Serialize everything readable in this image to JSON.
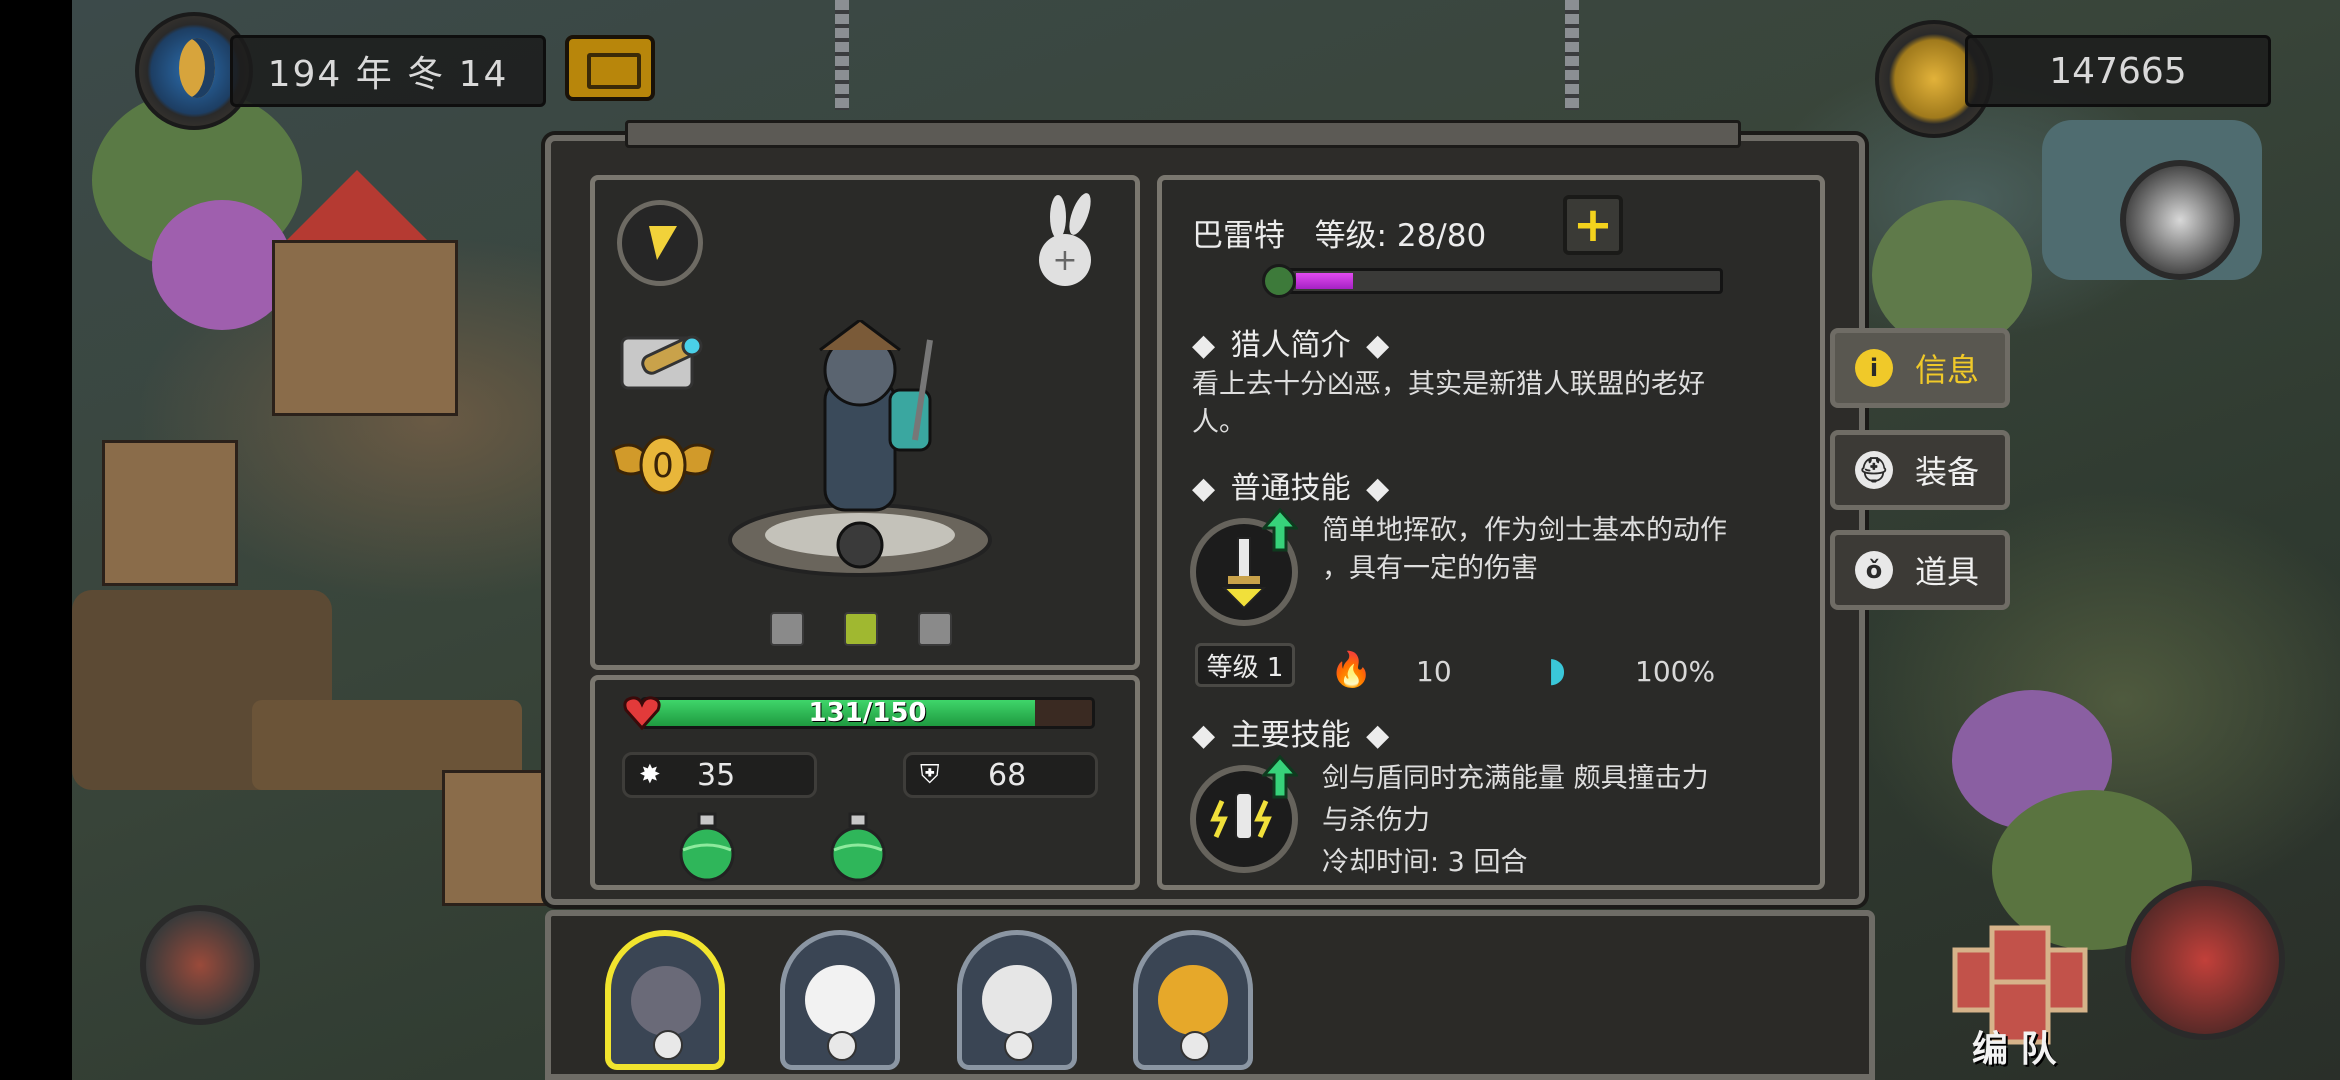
{
  "hud": {
    "date": "194 年 冬 14",
    "gold": "147665"
  },
  "hero": {
    "name": "巴雷特",
    "level_label": "等级: 28/80",
    "xp_fraction": 0.13,
    "rank_value": "0",
    "hp_text": "131/150",
    "hp_fraction": 0.873,
    "attack": "35",
    "defense": "68"
  },
  "profile": {
    "title": "猎人简介",
    "text_line1": "看上去十分凶恶，其实是新猎人联盟的老好",
    "text_line2": "人。"
  },
  "normal_skill": {
    "title": "普通技能",
    "desc_line1": "简单地挥砍，作为剑士基本的动作",
    "desc_line2": "，具有一定的伤害",
    "level": "等级 1",
    "cost": "10",
    "accuracy": "100%"
  },
  "main_skill": {
    "title": "主要技能",
    "desc_line1": "剑与盾同时充满能量 颇具撞击力",
    "desc_line2": "与杀伤力",
    "cooldown": "冷却时间: 3 回合"
  },
  "tabs": [
    {
      "label": "信息",
      "icon": "info-icon"
    },
    {
      "label": "装备",
      "icon": "helmet-icon"
    },
    {
      "label": "道具",
      "icon": "potion-icon"
    }
  ],
  "team_button": "编 队",
  "colors": {
    "hp": "#2fbf55",
    "xp": "#c52fe0",
    "selected": "#f1e42e",
    "accent_yellow": "#f0c929"
  }
}
